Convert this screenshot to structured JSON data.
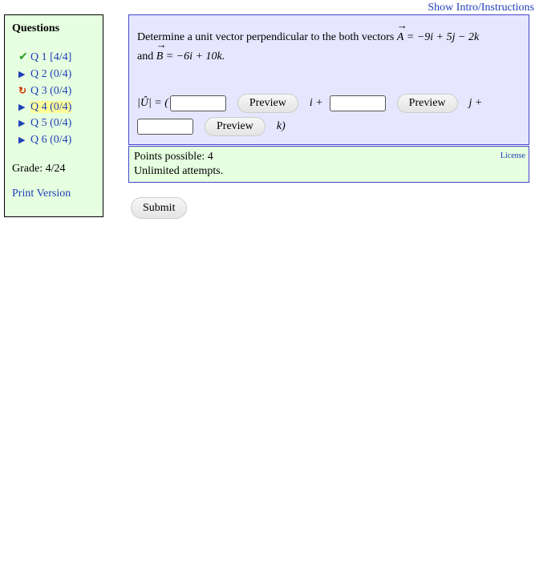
{
  "header": {
    "show_intro": "Show Intro/Instructions"
  },
  "sidebar": {
    "title": "Questions",
    "questions": [
      {
        "label": "Q 1",
        "score": "[4/4]",
        "status": "correct"
      },
      {
        "label": "Q 2",
        "score": "(0/4)",
        "status": "untried"
      },
      {
        "label": "Q 3",
        "score": "(0/4)",
        "status": "retry"
      },
      {
        "label": "Q 4",
        "score": "(0/4)",
        "status": "current"
      },
      {
        "label": "Q 5",
        "score": "(0/4)",
        "status": "untried"
      },
      {
        "label": "Q 6",
        "score": "(0/4)",
        "status": "untried"
      }
    ],
    "grade": "Grade: 4/24",
    "print_version": "Print Version"
  },
  "question": {
    "text_prefix": "Determine a unit vector perpendicular to the both vectors",
    "vector_a": "A",
    "vector_a_expr": "= −9i + 5j − 2k",
    "and_word": "and",
    "vector_b": "B",
    "vector_b_expr": "= −6i + 10k.",
    "answer_lhs": "|Û| = (",
    "i_term": "i +",
    "j_term": "j +",
    "k_term": "k)",
    "preview_label": "Preview",
    "answers": [
      "",
      "",
      ""
    ]
  },
  "info": {
    "points": "Points possible: 4",
    "attempts": "Unlimited attempts.",
    "license": "License"
  },
  "submit_label": "Submit",
  "colors": {
    "link": "#1f3fb8",
    "sidebar_bg": "#e6ffe0",
    "question_bg": "#e6e6ff",
    "check": "#2a9d2a",
    "retry": "#cc3300",
    "current_highlight": "#ffff99"
  },
  "icons": {
    "correct": "check-icon",
    "retry": "retry-icon",
    "untried": "triangle-right-icon"
  }
}
